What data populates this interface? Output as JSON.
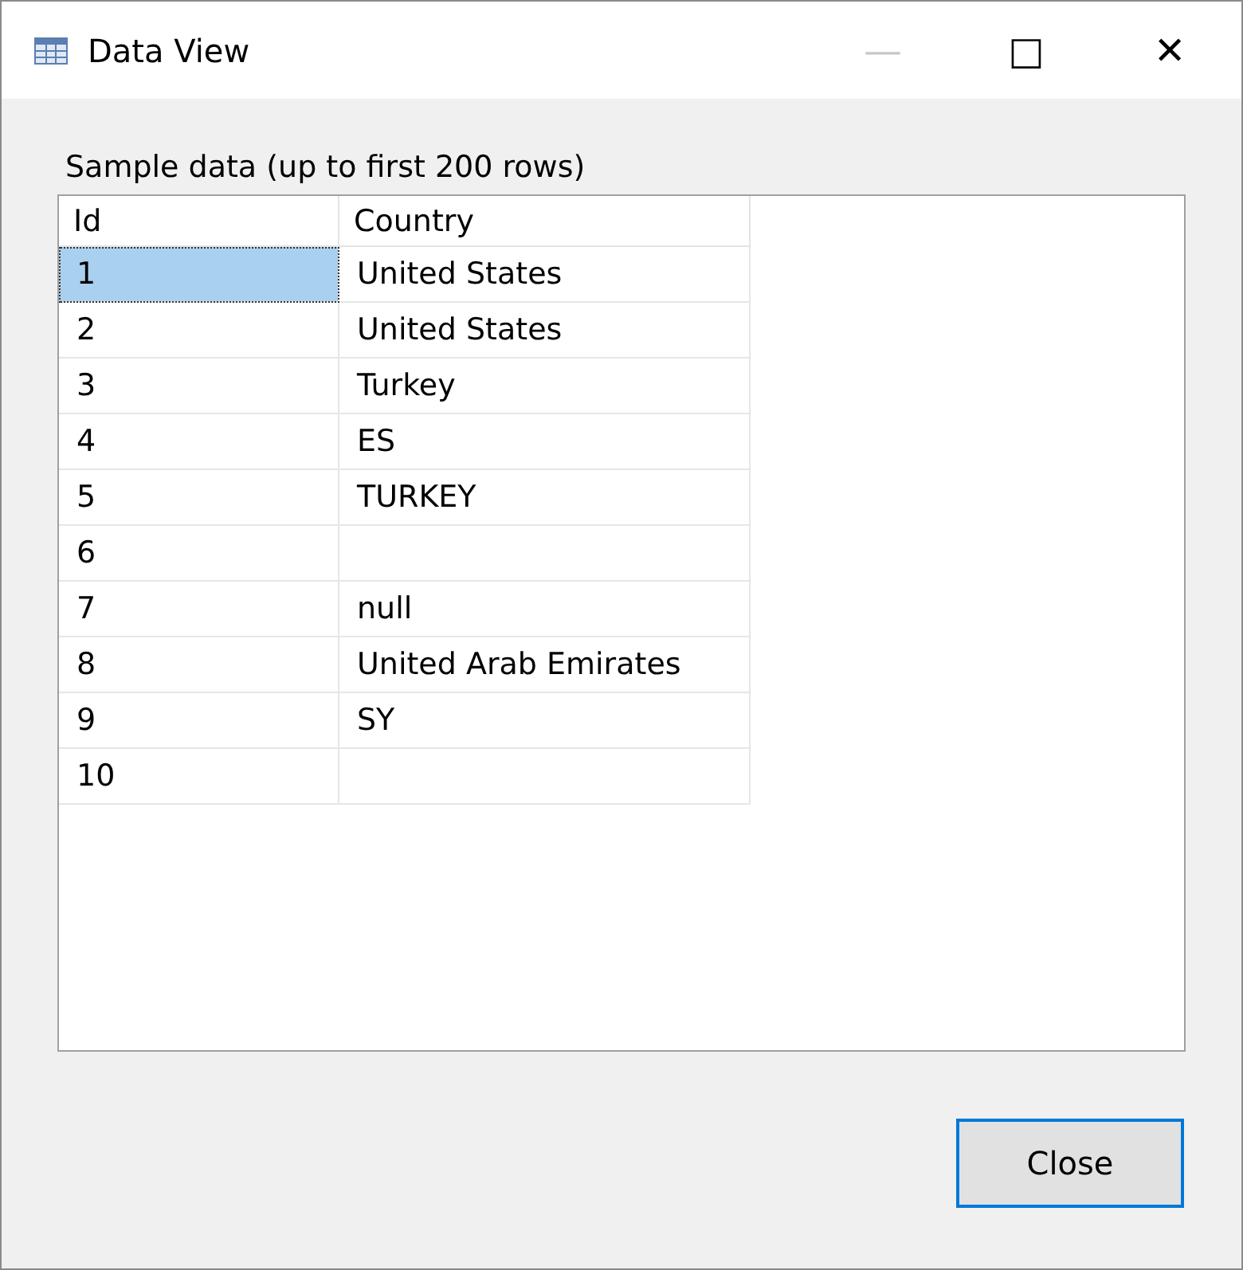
{
  "window": {
    "title": "Data View",
    "controls": [
      "—",
      "□",
      "✕"
    ]
  },
  "label": "Sample data (up to first 200 rows)",
  "table": {
    "columns": [
      "Id",
      "Country"
    ],
    "rows": [
      {
        "id": "1",
        "country": "United States",
        "selected": true
      },
      {
        "id": "2",
        "country": "United States",
        "selected": false
      },
      {
        "id": "3",
        "country": "Turkey",
        "selected": false
      },
      {
        "id": "4",
        "country": "ES",
        "selected": false
      },
      {
        "id": "5",
        "country": "TURKEY",
        "selected": false
      },
      {
        "id": "6",
        "selected": false
      },
      {
        "id": "7",
        "country": "null",
        "selected": false
      },
      {
        "id": "8",
        "country": "United Arab Emirates",
        "selected": false
      },
      {
        "id": "9",
        "country": "SY",
        "selected": false
      },
      {
        "id": "10",
        "selected": false
      }
    ]
  },
  "buttons": [
    "Close"
  ]
}
